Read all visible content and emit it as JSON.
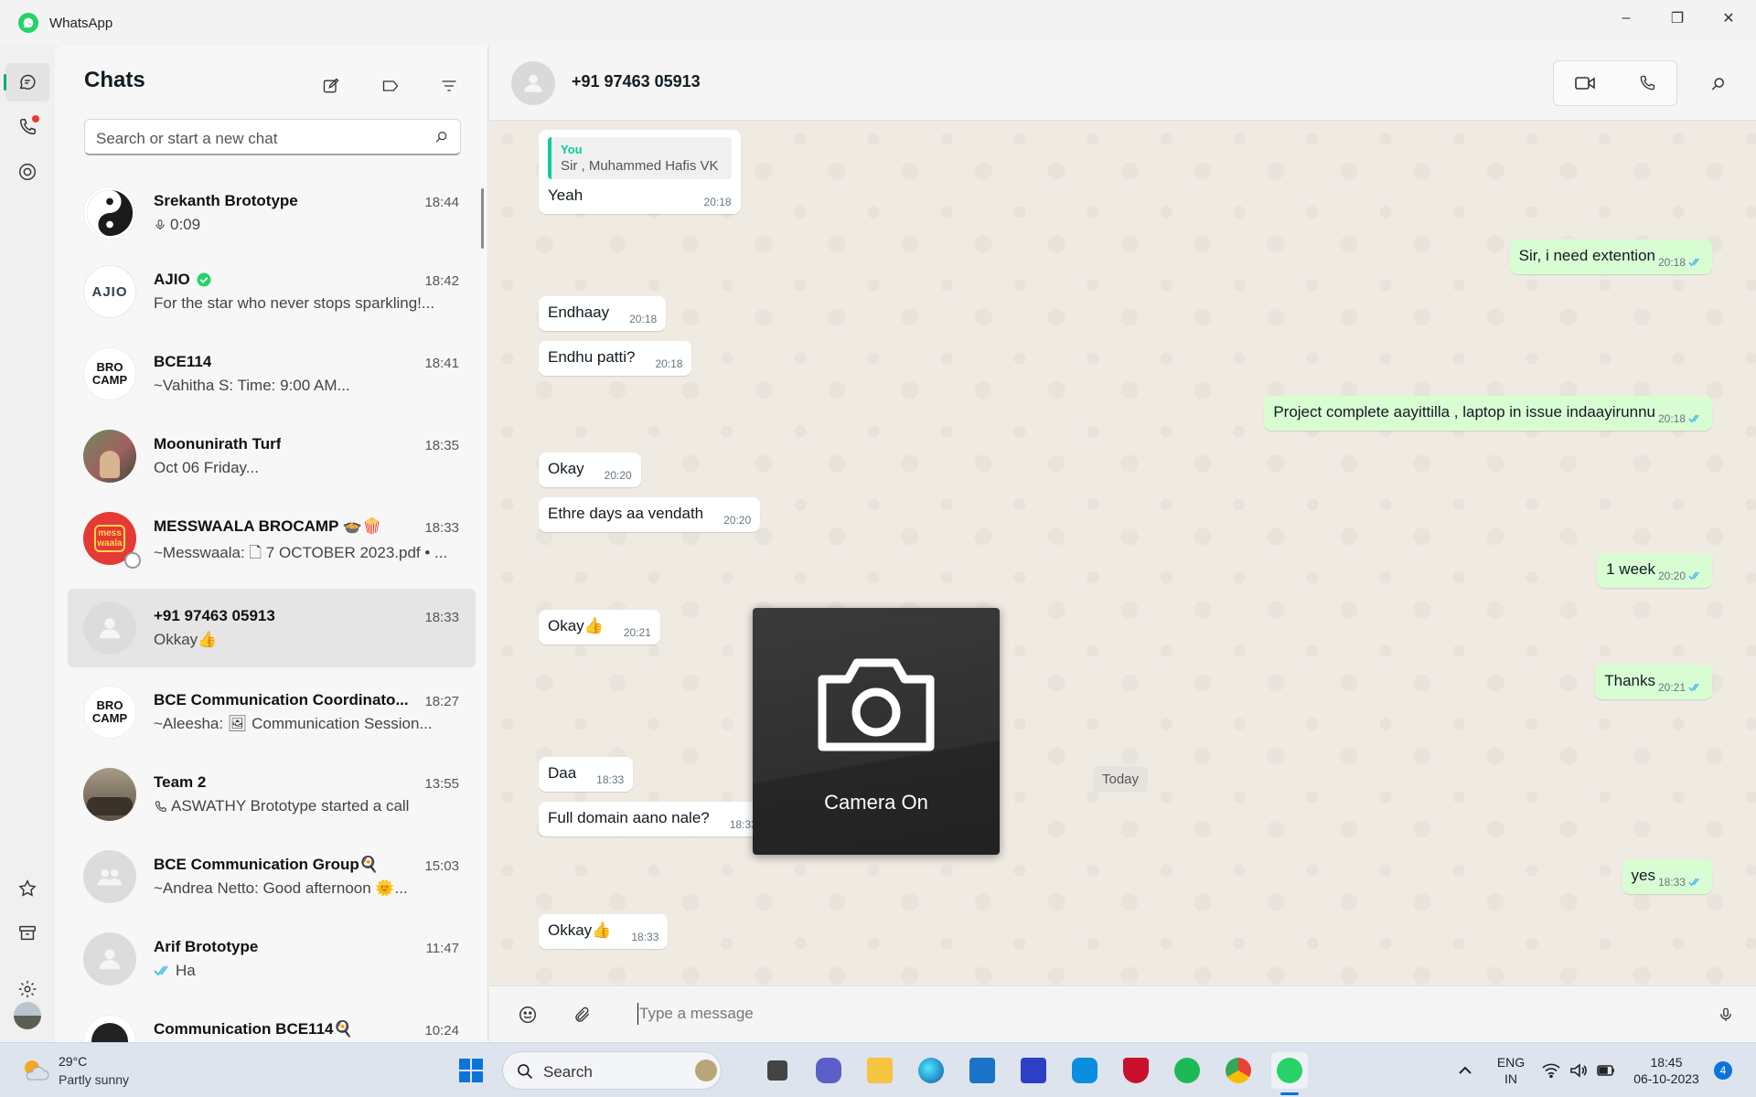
{
  "titlebar": {
    "app_title": "WhatsApp",
    "minimize": "–",
    "restore": "❐",
    "close": "✕"
  },
  "chatlist": {
    "heading": "Chats",
    "search_placeholder": "Search or start a new chat",
    "chats": [
      {
        "name": "Srekanth Brototype",
        "time": "18:44",
        "preview": "0:09",
        "prefix_icon": "mic-icon"
      },
      {
        "name": "AJIO",
        "time": "18:42",
        "preview": "For the star who never stops sparkling!...",
        "verified": true,
        "avatar_text": "AJIO"
      },
      {
        "name": "BCE114",
        "time": "18:41",
        "preview": "~Vahitha S: Time: 9:00 AM...",
        "avatar_text": "BRO CAMP"
      },
      {
        "name": "Moonunirath Turf",
        "time": "18:35",
        "preview": "Oct 06 Friday..."
      },
      {
        "name": "MESSWAALA BROCAMP 🍲🍿",
        "time": "18:33",
        "preview": "~Messwaala: 🗋 7 OCTOBER 2023.pdf • ...",
        "avatar_text": "mess waala"
      },
      {
        "name": "+91 97463 05913",
        "time": "18:33",
        "preview": "Okkay👍",
        "selected": true
      },
      {
        "name": "BCE Communication Coordinato...",
        "time": "18:27",
        "preview": "~Aleesha: 🖼 Communication Session...",
        "avatar_text": "BRO CAMP"
      },
      {
        "name": "Team 2",
        "time": "13:55",
        "preview": "ASWATHY Brototype started a call",
        "prefix_icon": "phone-icon"
      },
      {
        "name": "BCE Communication Group🍳",
        "time": "15:03",
        "preview": "~Andrea Netto: Good afternoon 🌞..."
      },
      {
        "name": "Arif Brototype",
        "time": "11:47",
        "preview": "Ha",
        "prefix_icon": "double-check-icon"
      },
      {
        "name": "Communication BCE114🍳",
        "time": "10:24",
        "preview": ""
      }
    ]
  },
  "conversation": {
    "contact": "+91 97463 05913",
    "composer_placeholder": "Type a message",
    "day_chip": "Today",
    "camera_label": "Camera On",
    "messages": [
      {
        "dir": "in",
        "text": "Yeah",
        "time": "20:18",
        "quote_name": "You",
        "quote_text": "Sir , Muhammed Hafis VK"
      },
      {
        "dir": "out",
        "text": "Sir, i need extention",
        "time": "20:18"
      },
      {
        "dir": "in",
        "text": "Endhaay",
        "time": "20:18"
      },
      {
        "dir": "in",
        "text": "Endhu patti?",
        "time": "20:18"
      },
      {
        "dir": "out",
        "text": "Project complete aayittilla , laptop in issue indaayirunnu",
        "time": "20:18"
      },
      {
        "dir": "in",
        "text": "Okay",
        "time": "20:20"
      },
      {
        "dir": "in",
        "text": "Ethre days aa vendath",
        "time": "20:20"
      },
      {
        "dir": "out",
        "text": "1 week",
        "time": "20:20"
      },
      {
        "dir": "in",
        "text": "Okay👍",
        "time": "20:21"
      },
      {
        "dir": "out",
        "text": "Thanks",
        "time": "20:21"
      },
      {
        "dir": "in",
        "text": "Daa",
        "time": "18:33"
      },
      {
        "dir": "in",
        "text": "Full domain aano nale?",
        "time": "18:33"
      },
      {
        "dir": "out",
        "text": "yes",
        "time": "18:33"
      },
      {
        "dir": "in",
        "text": "Okkay👍",
        "time": "18:33"
      }
    ]
  },
  "taskbar": {
    "weather_temp": "29°C",
    "weather_desc": "Partly sunny",
    "search_label": "Search",
    "lang_top": "ENG",
    "lang_bottom": "IN",
    "clock_time": "18:45",
    "clock_date": "06-10-2023",
    "notif_count": "4"
  },
  "colors": {
    "accent": "#00a884",
    "outgoing_bubble": "#d9fdd3",
    "incoming_bubble": "#ffffff",
    "read_ticks": "#53bdeb"
  }
}
